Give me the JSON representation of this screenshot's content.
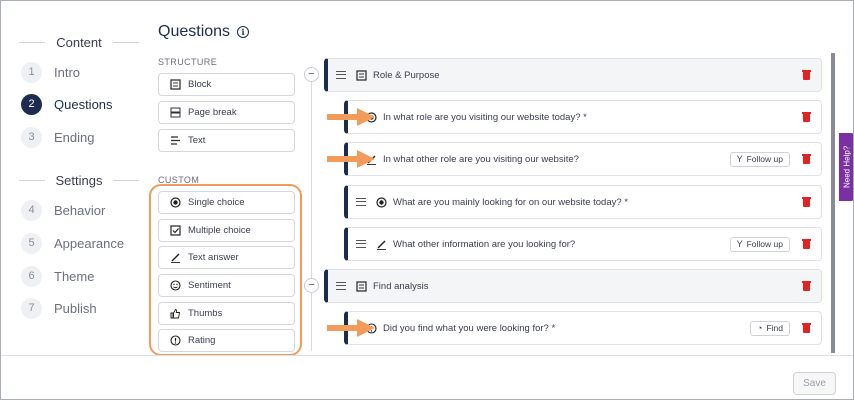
{
  "nav": {
    "content_heading": "Content",
    "settings_heading": "Settings",
    "content_steps": [
      {
        "num": "1",
        "label": "Intro"
      },
      {
        "num": "2",
        "label": "Questions"
      },
      {
        "num": "3",
        "label": "Ending"
      }
    ],
    "settings_steps": [
      {
        "num": "4",
        "label": "Behavior"
      },
      {
        "num": "5",
        "label": "Appearance"
      },
      {
        "num": "6",
        "label": "Theme"
      },
      {
        "num": "7",
        "label": "Publish"
      }
    ]
  },
  "page": {
    "title": "Questions"
  },
  "palette": {
    "structure_label": "STRUCTURE",
    "custom_label": "CUSTOM",
    "structure": [
      {
        "label": "Block",
        "icon": "block-icon"
      },
      {
        "label": "Page break",
        "icon": "page-break-icon"
      },
      {
        "label": "Text",
        "icon": "text-icon"
      }
    ],
    "custom": [
      {
        "label": "Single choice",
        "icon": "radio-icon"
      },
      {
        "label": "Multiple choice",
        "icon": "checkbox-icon"
      },
      {
        "label": "Text answer",
        "icon": "pencil-icon"
      },
      {
        "label": "Sentiment",
        "icon": "smiley-icon"
      },
      {
        "label": "Thumbs",
        "icon": "thumbs-up-icon"
      },
      {
        "label": "Rating",
        "icon": "rating-icon"
      }
    ]
  },
  "tree": {
    "blocks": [
      {
        "label": "Role & Purpose"
      },
      {
        "label": "Find analysis"
      }
    ],
    "questions": [
      {
        "label": "In what role are you visiting our website today? *",
        "icon": "radio-icon",
        "chip": ""
      },
      {
        "label": "In what other role are you visiting our website?",
        "icon": "pencil-icon",
        "chip": "Follow up"
      },
      {
        "label": "What are you mainly looking for on our website today? *",
        "icon": "radio-icon",
        "chip": ""
      },
      {
        "label": "What other information are you looking for?",
        "icon": "pencil-icon",
        "chip": "Follow up"
      },
      {
        "label": "Did you find what you were looking for? *",
        "icon": "rating-icon",
        "chip": "Find"
      }
    ]
  },
  "footer": {
    "save_label": "Save"
  },
  "help_tab": "Need Help?",
  "colors": {
    "accent": "#1d2c4c",
    "highlight": "#f29b5a",
    "delete": "#e02424",
    "help": "#7b2fa5"
  }
}
